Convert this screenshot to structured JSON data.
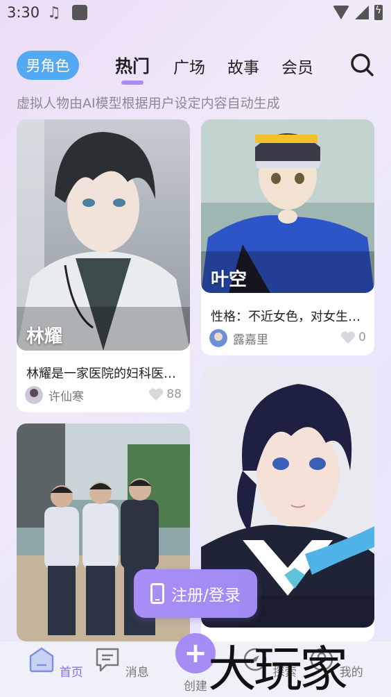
{
  "status_bar": {
    "time": "3:30"
  },
  "top_nav": {
    "gender_filter": "男角色",
    "tabs": [
      {
        "label": "热门",
        "active": true
      },
      {
        "label": "广场",
        "active": false
      },
      {
        "label": "故事",
        "active": false
      },
      {
        "label": "会员",
        "active": false
      }
    ]
  },
  "subtitle": "虚拟人物由AI模型根据用户设定内容自动生成",
  "cards": [
    {
      "name": "林耀",
      "description": "林耀是一家医院的妇科医…",
      "author": "许仙寒",
      "likes": "88"
    },
    {
      "name": "叶空",
      "description": "性格：不近女色，对女生…",
      "author": "露嘉里",
      "likes": "0"
    },
    {
      "name": "",
      "description": "",
      "author": "",
      "likes": ""
    },
    {
      "name": "",
      "description": "",
      "author": "",
      "likes": ""
    }
  ],
  "login_button": "注册/登录",
  "bottom_nav": {
    "items": [
      {
        "label": "首页",
        "active": true
      },
      {
        "label": "消息",
        "active": false
      },
      {
        "label": "创建",
        "active": false
      },
      {
        "label": "探索",
        "active": false
      },
      {
        "label": "我的",
        "active": false
      }
    ]
  },
  "watermark": "大玩家",
  "colors": {
    "accent": "#a58cf4",
    "pill": "#55a8f2",
    "background": "#eee8f8"
  }
}
